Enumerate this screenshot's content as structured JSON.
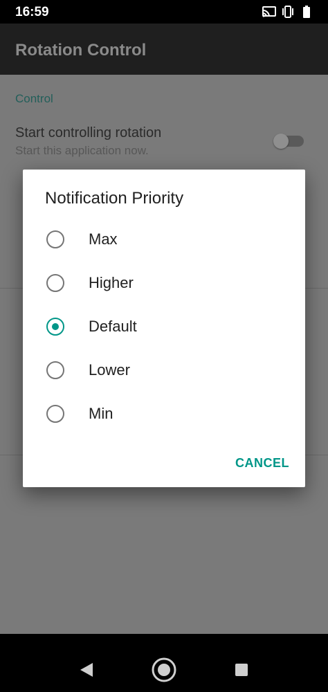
{
  "status_bar": {
    "time": "16:59",
    "icons": [
      "cast-icon",
      "vibrate-icon",
      "battery-icon"
    ]
  },
  "app_bar": {
    "title": "Rotation Control"
  },
  "settings": {
    "category_control": "Control",
    "start_title": "Start controlling rotation",
    "start_summary": "Start this application now.",
    "switch_on": false
  },
  "dialog": {
    "title": "Notification Priority",
    "options": [
      {
        "label": "Max",
        "selected": false
      },
      {
        "label": "Higher",
        "selected": false
      },
      {
        "label": "Default",
        "selected": true
      },
      {
        "label": "Lower",
        "selected": false
      },
      {
        "label": "Min",
        "selected": false
      }
    ],
    "cancel_label": "CANCEL"
  },
  "nav_bar": {
    "icons": [
      "back-icon",
      "home-icon",
      "recents-icon"
    ]
  },
  "colors": {
    "accent": "#009688",
    "scrim": "#7a7a7a"
  }
}
